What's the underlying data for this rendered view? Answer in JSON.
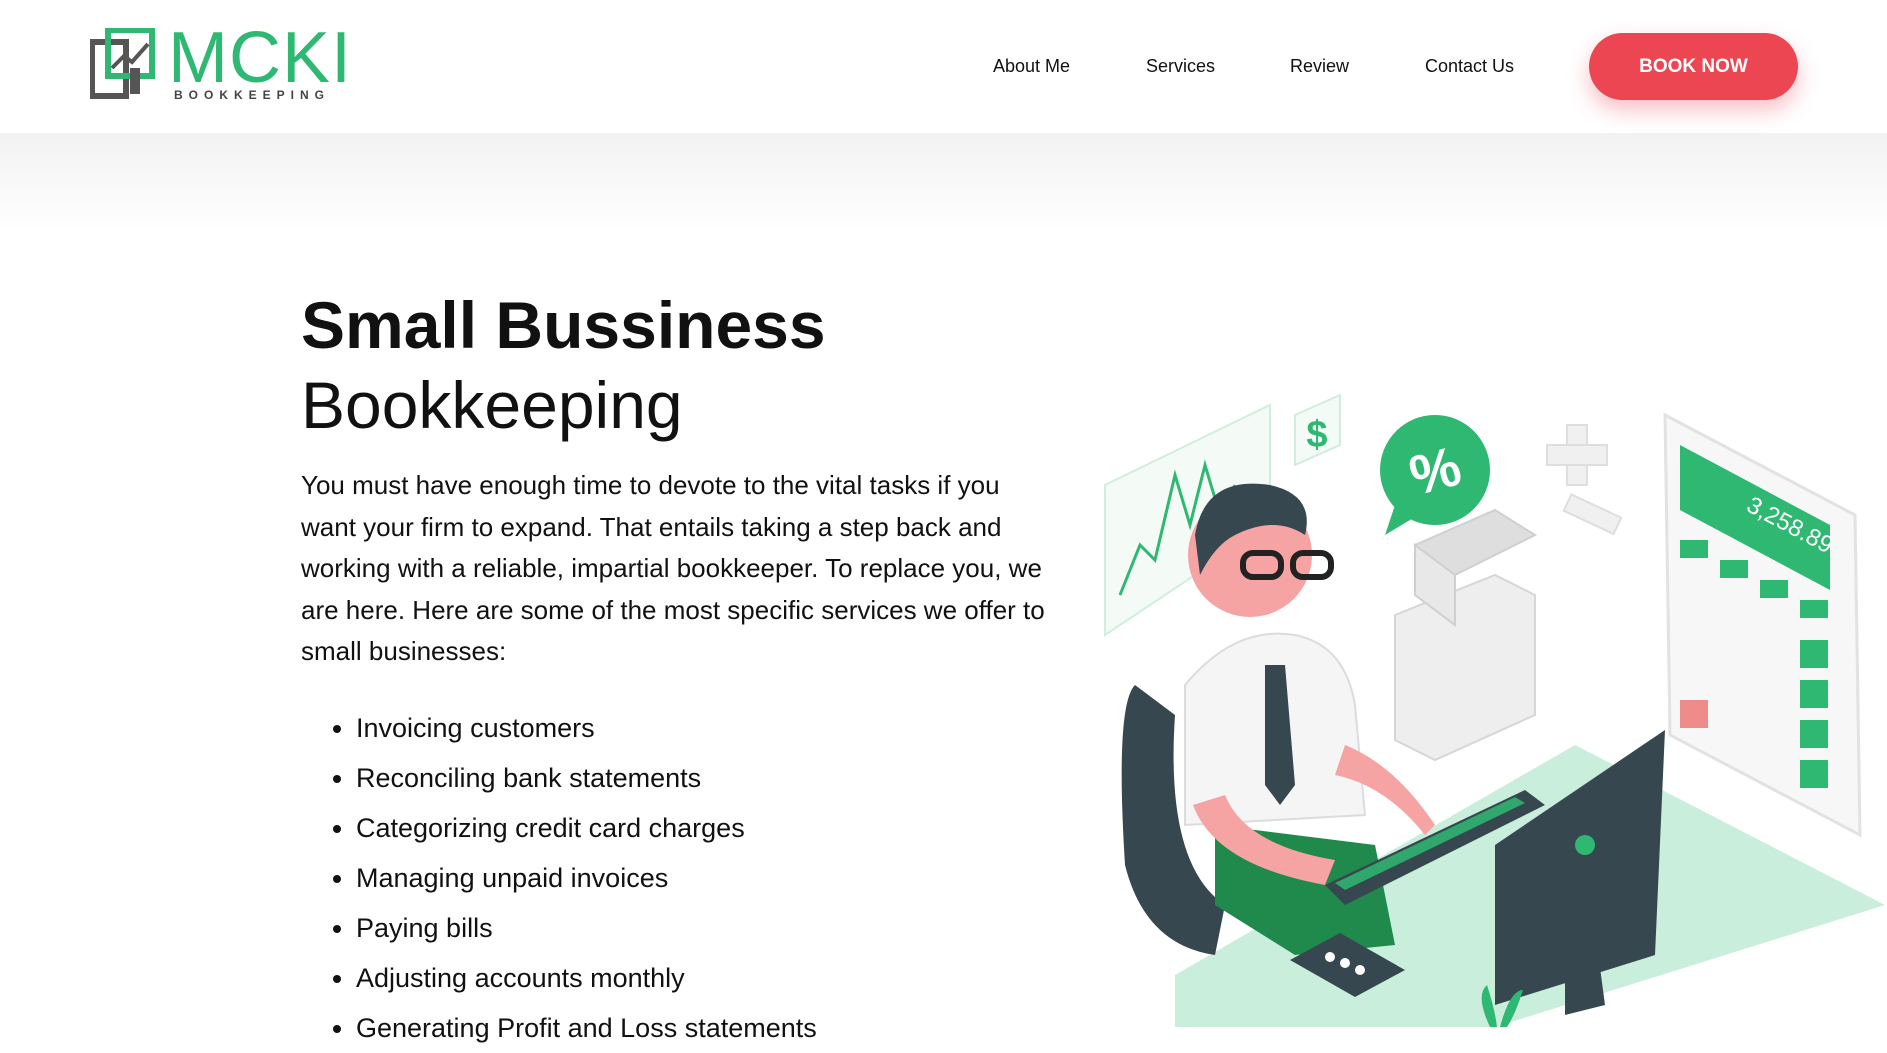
{
  "header": {
    "logo": {
      "word": "MCKI",
      "sub": "BOOKKEEPING"
    },
    "nav": [
      {
        "label": "About Me"
      },
      {
        "label": "Services"
      },
      {
        "label": "Review"
      },
      {
        "label": "Contact Us"
      }
    ],
    "cta_label": "BOOK NOW"
  },
  "main": {
    "title_bold": "Small Bussiness",
    "title_regular": "Bookkeeping",
    "intro": "You must have enough time to devote to the vital tasks if you want your firm to expand. That entails taking a step back and working with a reliable, impartial bookkeeper. To replace you, we are here. Here are some of the most specific services we offer to small businesses:",
    "services": [
      "Invoicing customers",
      "Reconciling bank statements",
      "Categorizing credit card charges",
      "Managing unpaid invoices",
      "Paying bills",
      "Adjusting accounts monthly",
      "Generating Profit and Loss statements"
    ]
  },
  "illustration": {
    "calculator_display": "3,258.89",
    "percent_symbol": "%",
    "dollar_symbol": "$"
  },
  "colors": {
    "brand_green": "#2eb872",
    "cta_red": "#ec4653",
    "dark": "#37474f"
  }
}
